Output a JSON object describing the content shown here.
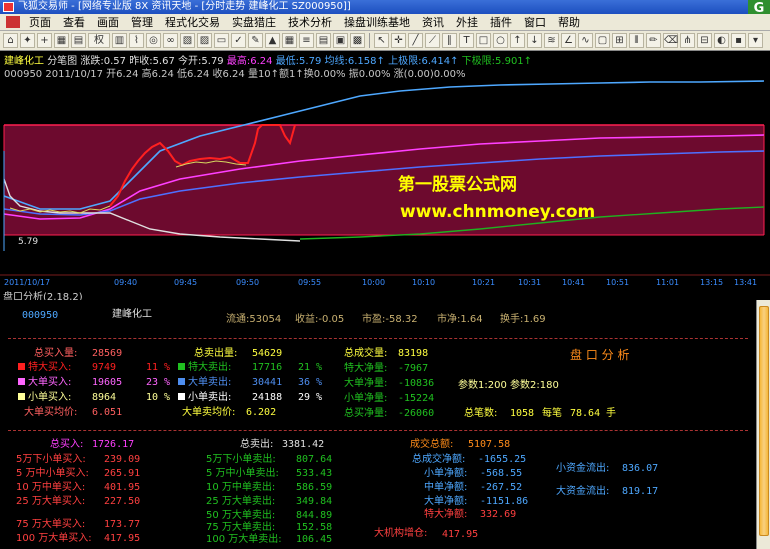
{
  "window": {
    "title": "飞狐交易师 - [网络专业版 8X 资讯天地 - [分时走势 建峰化工 SZ000950]]"
  },
  "menu": [
    "页面",
    "查看",
    "画面",
    "管理",
    "程式化交易",
    "实盘猎庄",
    "技术分析",
    "操盘训练基地",
    "资讯",
    "外挂",
    "插件",
    "窗口",
    "帮助"
  ],
  "toolbar": {
    "period": "权"
  },
  "header": {
    "name": "建峰化工",
    "chart_kind": "分笔图",
    "change": "涨跌:0.57",
    "prev_close": "昨收:5.67",
    "open": "今开:5.79",
    "high": "最高:6.24",
    "low": "最低:5.79",
    "avg": "均线:6.158↑",
    "upper": "上极限:6.414↑",
    "lower": "下极限:5.901↑"
  },
  "quote_line": "000950 2011/10/17 开6.24 高6.24 低6.24 收6.24 量10↑额1↑换0.00% 振0.00% 涨(0.00)0.00%",
  "watermark": {
    "line1": "第一股票公式网",
    "line2": "www.chnmoney.com"
  },
  "chart_data": {
    "type": "line",
    "y_tick_labels": [
      "5.79"
    ],
    "x_tick_labels": [
      "2011/10/17",
      "09:40",
      "09:45",
      "09:50",
      "09:55",
      "10:00",
      "10:10",
      "10:21",
      "10:31",
      "10:41",
      "10:51",
      "11:01",
      "13:15",
      "13:41"
    ],
    "colors": {
      "price": "#ff2020",
      "band": "#6d0a2e",
      "upper": "#ff40ff",
      "avg": "#4ea8ff",
      "low": "#20b020",
      "white": "#e0e0e0"
    }
  },
  "panel": {
    "title": "盘口分析(2,18,2)",
    "code": "000950",
    "name": "建峰化工",
    "stats": [
      "流通:53054",
      "收益:-0.05",
      "市盈:-58.32",
      "市净:1.64",
      "换手:1.69"
    ],
    "buy": {
      "total": {
        "label": "总买入量:",
        "value": "28569"
      },
      "rows": [
        {
          "label": "特大买入:",
          "value": "9749",
          "pct": "11 %",
          "color": "#ff2020"
        },
        {
          "label": "大单买入:",
          "value": "19605",
          "pct": "23 %",
          "color": "#ff66ff"
        },
        {
          "label": "小单买入:",
          "value": "8964",
          "pct": "10 %",
          "color": "#ffff99"
        }
      ],
      "avg": {
        "label": "大单买均价:",
        "value": "6.051"
      }
    },
    "sell": {
      "total": {
        "label": "总卖出量:",
        "value": "54629"
      },
      "rows": [
        {
          "label": "特大卖出:",
          "value": "17716",
          "pct": "21 %",
          "color": "#20c020"
        },
        {
          "label": "大单卖出:",
          "value": "30441",
          "pct": "36 %",
          "color": "#4e8ef0"
        },
        {
          "label": "小单卖出:",
          "value": "24188",
          "pct": "29 %",
          "color": "#ffffff"
        }
      ],
      "avg": {
        "label": "大单卖均价:",
        "value": "6.202"
      }
    },
    "net": [
      {
        "label": "总成交量:",
        "value": "83198"
      },
      {
        "label": "特大净量:",
        "value": "-7967"
      },
      {
        "label": "大单净量:",
        "value": "-10836"
      },
      {
        "label": "小单净量:",
        "value": "-15224"
      },
      {
        "label": "总买净量:",
        "value": "-26060"
      }
    ],
    "analysis_title": "盘 口 分 析",
    "params": "参数1:200 参数2:180",
    "total_count": {
      "label": "总笔数:",
      "value": "1058",
      "per_label": "每笔",
      "per_value": "78.64",
      "unit": "手"
    },
    "amounts_buy": {
      "total": {
        "label": "总买入:",
        "value": "1726.17"
      },
      "rows": [
        {
          "label": "5万下小单买入:",
          "value": "239.09"
        },
        {
          "label": "5 万中小单买入:",
          "value": "265.91"
        },
        {
          "label": "10 万中单买入:",
          "value": "401.95"
        },
        {
          "label": "25 万大单买入:",
          "value": "227.50"
        },
        {
          "label": "75 万大单买入:",
          "value": "173.77"
        },
        {
          "label": "100 万大单买入:",
          "value": "417.95"
        }
      ]
    },
    "amounts_sell": {
      "total": {
        "label": "总卖出:",
        "value": "3381.42"
      },
      "rows": [
        {
          "label": "5万下小单卖出:",
          "value": "807.64"
        },
        {
          "label": "5 万中小单卖出:",
          "value": "533.43"
        },
        {
          "label": "10 万中单卖出:",
          "value": "586.59"
        },
        {
          "label": "25 万大单卖出:",
          "value": "349.84"
        },
        {
          "label": "50 万大单卖出:",
          "value": "844.89"
        },
        {
          "label": "75 万大单卖出:",
          "value": "152.58"
        },
        {
          "label": "100 万大单卖出:",
          "value": "106.45"
        }
      ]
    },
    "amounts_net": {
      "total": {
        "label": "成交总额:",
        "value": "5107.58"
      },
      "rows": [
        {
          "label": "总成交净额:",
          "value": "-1655.25"
        },
        {
          "label": "小单净额:",
          "value": "-568.55"
        },
        {
          "label": "中单净额:",
          "value": "-267.52"
        },
        {
          "label": "大单净额:",
          "value": "-1151.86"
        },
        {
          "label": "特大净额:",
          "value": "332.69"
        }
      ]
    },
    "flows": [
      {
        "label": "小资金流出:",
        "value": "836.07"
      },
      {
        "label": "大资金流出:",
        "value": "819.17"
      }
    ],
    "institution": {
      "label": "大机构增仓:",
      "value": "417.95"
    }
  }
}
